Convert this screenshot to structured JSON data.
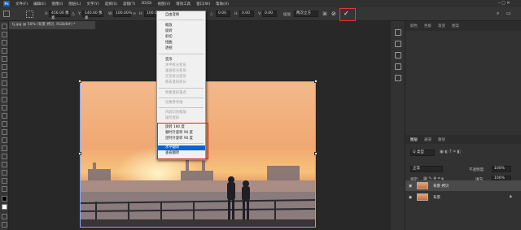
{
  "menubar": {
    "items": [
      "文件(F)",
      "编辑(E)",
      "图像(I)",
      "图层(L)",
      "文字(Y)",
      "选择(S)",
      "滤镜(T)",
      "3D(D)",
      "视图(V)",
      "增效工具",
      "窗口(W)",
      "帮助(H)"
    ],
    "logo": "Ps"
  },
  "options": {
    "x_label": "X:",
    "x_value": "456.00 像素",
    "y_label": "Y:",
    "y_value": "140.00 像素",
    "w_label": "W:",
    "w_value": "100.00%",
    "h_label": "H:",
    "h_value": "100.00%",
    "angle_label": "△",
    "angle_value": "0.00",
    "hskew_label": "H:",
    "hskew_value": "0.00",
    "vskew_label": "V:",
    "vskew_value": "0.00",
    "interp_label": "插值",
    "interp_value": "两次立方"
  },
  "document": {
    "tab_label": "tj.jpg @ 50% (背景 拷贝, RGB/8#) *"
  },
  "dropdown": {
    "items": [
      {
        "label": "自由变换",
        "disabled": false
      },
      {
        "label": "缩放",
        "disabled": false
      },
      {
        "label": "旋转",
        "disabled": false
      },
      {
        "label": "斜切",
        "disabled": false
      },
      {
        "label": "扭曲",
        "disabled": false
      },
      {
        "label": "透视",
        "disabled": false
      },
      {
        "label": "变形",
        "disabled": false
      },
      {
        "label": "水平拆分变形",
        "disabled": true
      },
      {
        "label": "垂直拆分变形",
        "disabled": true
      },
      {
        "label": "交叉拆分变形",
        "disabled": true
      },
      {
        "label": "移去变形拆分",
        "disabled": true
      },
      {
        "label": "转换变形锚点",
        "disabled": true
      },
      {
        "label": "切换参考线",
        "disabled": true
      },
      {
        "label": "内容识别缩放",
        "disabled": true
      },
      {
        "label": "操控变形",
        "disabled": true
      },
      {
        "label": "旋转 180 度",
        "disabled": false
      },
      {
        "label": "顺时针旋转 90 度",
        "disabled": false
      },
      {
        "label": "逆时针旋转 90 度",
        "disabled": false
      },
      {
        "label": "水平翻转",
        "disabled": false,
        "selected": true
      },
      {
        "label": "垂直翻转",
        "disabled": false
      }
    ]
  },
  "panels": {
    "top_tabs": [
      "颜色",
      "色板",
      "渐变",
      "图案"
    ],
    "layers_tabs": [
      "图层",
      "通道",
      "路径"
    ],
    "kind_label": "Q 类型",
    "blend_mode": "正常",
    "opacity_label": "不透明度:",
    "opacity_value": "100%",
    "lock_label": "锁定:",
    "fill_label": "填充:",
    "fill_value": "100%",
    "layers": [
      {
        "name": "背景 拷贝",
        "selected": true
      },
      {
        "name": "背景",
        "selected": false
      }
    ]
  },
  "colors": {
    "accent": "#0a64c9",
    "highlight_red": "#dd2222"
  }
}
